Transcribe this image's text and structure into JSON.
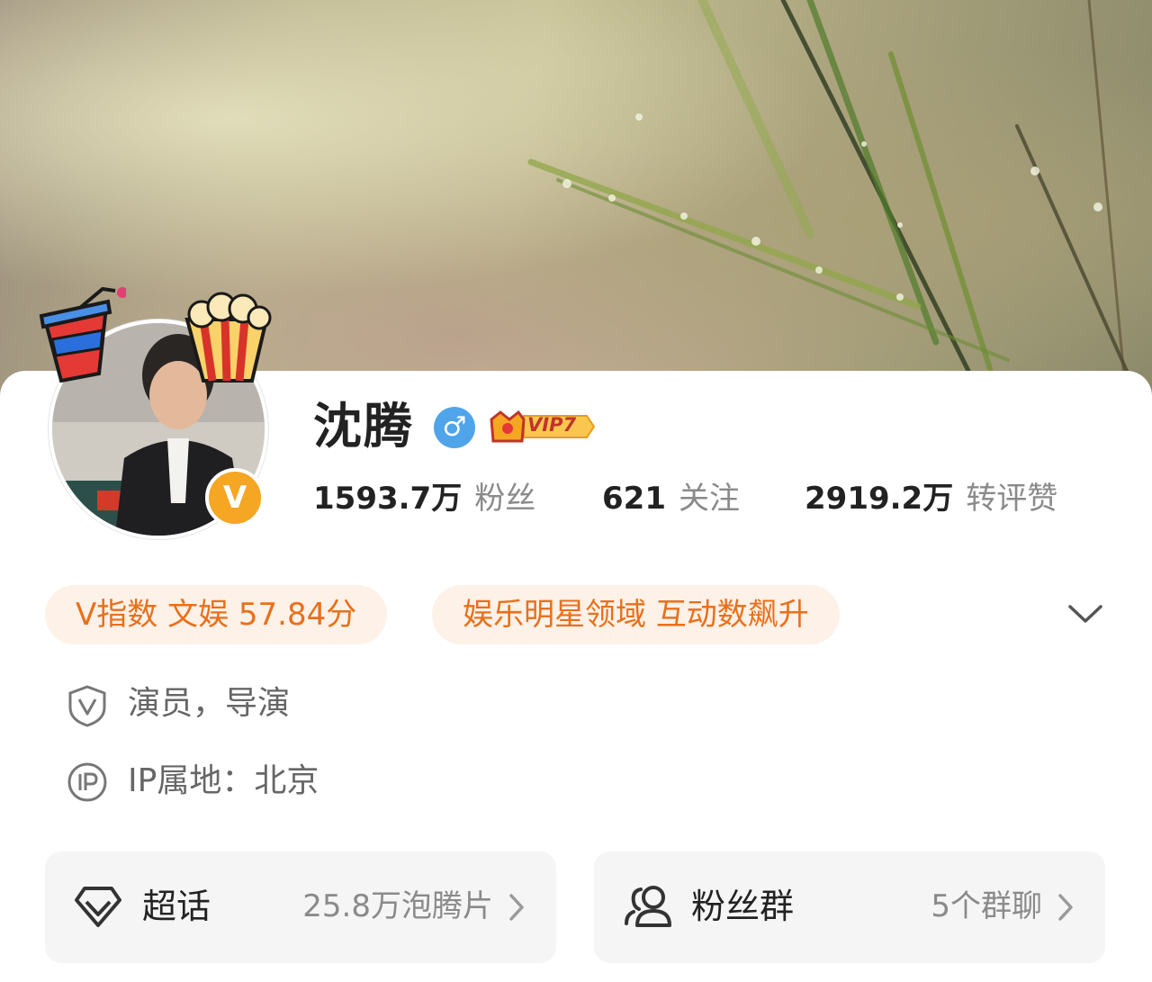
{
  "profile": {
    "name": "沈腾",
    "gender_symbol": "♂",
    "vip_label": "VIP7",
    "verified_mark": "V"
  },
  "stats": [
    {
      "value": "1593.7万",
      "label": "粉丝"
    },
    {
      "value": "621",
      "label": "关注"
    },
    {
      "value": "2919.2万",
      "label": "转评赞"
    }
  ],
  "tags": [
    {
      "text": "V指数 文娱 57.84分"
    },
    {
      "text": "娱乐明星领域 互动数飙升"
    }
  ],
  "info": {
    "occupation": "演员，导演",
    "ip_location": "IP属地：北京"
  },
  "boxes": {
    "super_topic": {
      "title": "超话",
      "meta": "25.8万泡腾片"
    },
    "fan_group": {
      "title": "粉丝群",
      "meta": "5个群聊"
    }
  },
  "colors": {
    "accent_orange": "#e8701b",
    "chip_bg": "#fdf1e8",
    "gender_blue": "#4fa4ea",
    "verified_gold": "#f5a623"
  },
  "icons": {
    "gender": "male-icon",
    "vip": "vip-crown-icon",
    "expand": "chevron-down-icon",
    "verified": "shield-v-icon",
    "ip": "ip-circle-icon",
    "super_topic": "diamond-icon",
    "fan_group": "people-icon",
    "arrow": "chevron-right-icon"
  }
}
